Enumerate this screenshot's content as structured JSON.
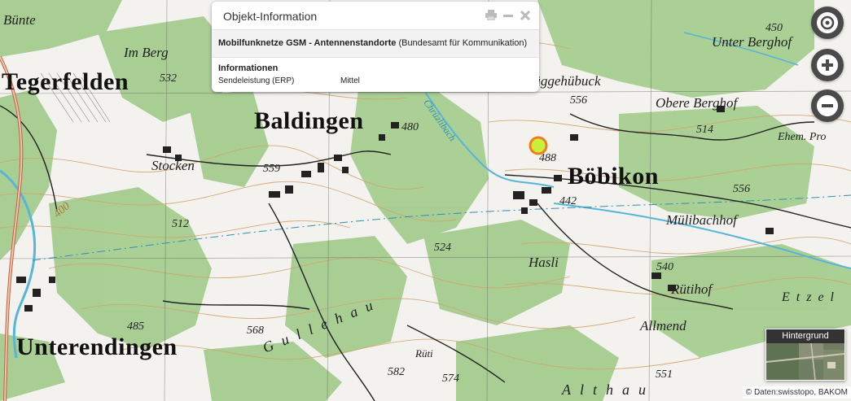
{
  "popup": {
    "title": "Objekt-Information",
    "layer_name": "Mobilfunknetze GSM - Antennenstandorte",
    "layer_source": "(Bundesamt für Kommunikation)",
    "section_heading": "Informationen",
    "rows": [
      {
        "key": "Sendeleistung (ERP)",
        "value": "Mittel"
      }
    ]
  },
  "navigation": {
    "buttons": [
      {
        "name": "locate-button",
        "icon": "target-icon"
      },
      {
        "name": "zoom-in-button",
        "icon": "plus-icon"
      },
      {
        "name": "zoom-out-button",
        "icon": "minus-icon"
      }
    ]
  },
  "background_switcher": {
    "label": "Hintergrund"
  },
  "attribution": "© Daten:swisstopo, BAKOM",
  "marker": {
    "color_fill": "#c8f03a",
    "color_ring": "#f07d1c"
  },
  "colors": {
    "forest": "#9fcb8c",
    "open": "#f4f2ee",
    "contour": "#d2a46a",
    "road": "#222222",
    "water": "#57b6d6"
  },
  "map_labels": {
    "towns": [
      "Tegerfelden",
      "Baldingen",
      "Böbikon",
      "Unterendingen"
    ],
    "localities": [
      "Bünte",
      "Im Berg",
      "Stocken",
      "Hasli",
      "Rütihof",
      "Allmend",
      "Rüti",
      "Mülibachhof",
      "Obere Berghof",
      "Unter Berghof",
      "Ehem. Pro",
      "Rüggehübuck",
      "Etzel"
    ],
    "fields": [
      "Gullehau",
      "Althau"
    ],
    "elevations": [
      "532",
      "480",
      "556",
      "450",
      "514",
      "488",
      "442",
      "556",
      "559",
      "512",
      "524",
      "540",
      "568",
      "485",
      "582",
      "574",
      "551"
    ],
    "contours": [
      "400"
    ],
    "streams": [
      "Chrüzlibach"
    ]
  }
}
